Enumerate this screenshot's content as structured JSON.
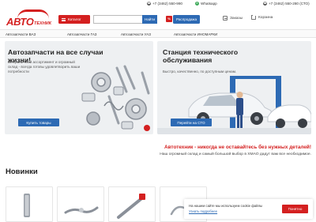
{
  "topbar": {
    "phone1": "+7 (3462) 550-990",
    "messenger": "Whatsapp",
    "phone2": "+7 (3462) 550-280 (СТО)"
  },
  "logo": {
    "main": "АВТО",
    "sub": "ТЕХНИК"
  },
  "header": {
    "catalog_label": "Каталог",
    "search_placeholder": "",
    "search_label": "Найти",
    "sale_badge": "%",
    "sale_label": "Распродажа",
    "orders_label": "Заказы",
    "cart_label": "Корзина"
  },
  "categories": [
    "Автозапчасти ВАЗ",
    "Автозапчасти ГАЗ",
    "Автозапчасти УАЗ",
    "Автозапчасти ИНОМАРКИ"
  ],
  "banners": {
    "parts": {
      "title": "Автозапчасти на все случаи жизни!",
      "text": "Безграничный ассортимент и огромный склад - всегда готовы удовлетворить ваши потребности",
      "button": "Купить товары"
    },
    "service": {
      "title": "Станция технического обслуживания",
      "text": "Быстро, качественно, по доступным ценам.",
      "button": "Перейти на СТО"
    }
  },
  "slogan": {
    "main": "Автотехник - никогда не оставайтесь без нужных деталей!",
    "sub": "Наш огромный склад и самый большой выбор в ХМАО дадут вам все необходимое."
  },
  "new_section": {
    "title": "Новинки"
  },
  "cookie": {
    "text": "На нашем сайте мы используем cookie файлы",
    "link": "Узнать подробнее",
    "button": "Понятно"
  },
  "colors": {
    "brand_red": "#d42020",
    "brand_blue": "#2d6ab4",
    "banner_bg": "#eef0f2"
  }
}
